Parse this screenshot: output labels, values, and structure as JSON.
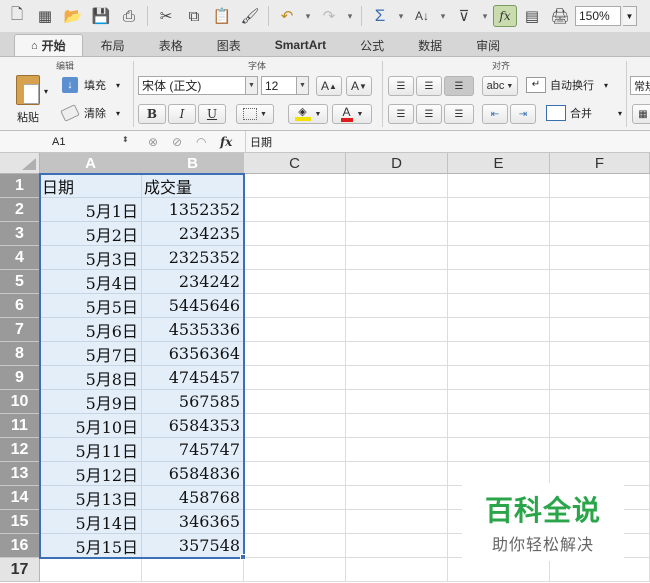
{
  "toolbar": {
    "zoom": "150%",
    "fx_label": "fx"
  },
  "tabs": [
    {
      "label": "开始",
      "active": true
    },
    {
      "label": "布局"
    },
    {
      "label": "表格"
    },
    {
      "label": "图表"
    },
    {
      "label": "SmartArt"
    },
    {
      "label": "公式"
    },
    {
      "label": "数据"
    },
    {
      "label": "审阅"
    }
  ],
  "ribbon": {
    "edit_group": "编辑",
    "font_group": "字体",
    "align_group": "对齐",
    "paste_label": "粘贴",
    "fill_label": "填充",
    "clear_label": "清除",
    "font_name": "宋体 (正文)",
    "font_size": "12",
    "bold": "B",
    "italic": "I",
    "underline": "U",
    "font_grow": "A",
    "font_shrink": "A",
    "font_color": "A",
    "wrap_style": "abc",
    "wrap_label": "自动换行",
    "merge_label": "合并",
    "number_format": "常规"
  },
  "formula_bar": {
    "name_box": "A1",
    "content": "日期"
  },
  "columns": [
    "A",
    "B",
    "C",
    "D",
    "E",
    "F"
  ],
  "rows": [
    {
      "num": "1",
      "a": "日期",
      "b": "成交量"
    },
    {
      "num": "2",
      "a": "5月1日",
      "b": "1352352"
    },
    {
      "num": "3",
      "a": "5月2日",
      "b": "234235"
    },
    {
      "num": "4",
      "a": "5月3日",
      "b": "2325352"
    },
    {
      "num": "5",
      "a": "5月4日",
      "b": "234242"
    },
    {
      "num": "6",
      "a": "5月5日",
      "b": "5445646"
    },
    {
      "num": "7",
      "a": "5月6日",
      "b": "4535336"
    },
    {
      "num": "8",
      "a": "5月7日",
      "b": "6356364"
    },
    {
      "num": "9",
      "a": "5月8日",
      "b": "4745457"
    },
    {
      "num": "10",
      "a": "5月9日",
      "b": "567585"
    },
    {
      "num": "11",
      "a": "5月10日",
      "b": "6584353"
    },
    {
      "num": "12",
      "a": "5月11日",
      "b": "745747"
    },
    {
      "num": "13",
      "a": "5月12日",
      "b": "6584836"
    },
    {
      "num": "14",
      "a": "5月13日",
      "b": "458768"
    },
    {
      "num": "15",
      "a": "5月14日",
      "b": "346365"
    },
    {
      "num": "16",
      "a": "5月15日",
      "b": "357548"
    },
    {
      "num": "17",
      "a": "",
      "b": ""
    }
  ],
  "watermark": {
    "title": "百科全说",
    "subtitle": "助你轻松解决"
  }
}
